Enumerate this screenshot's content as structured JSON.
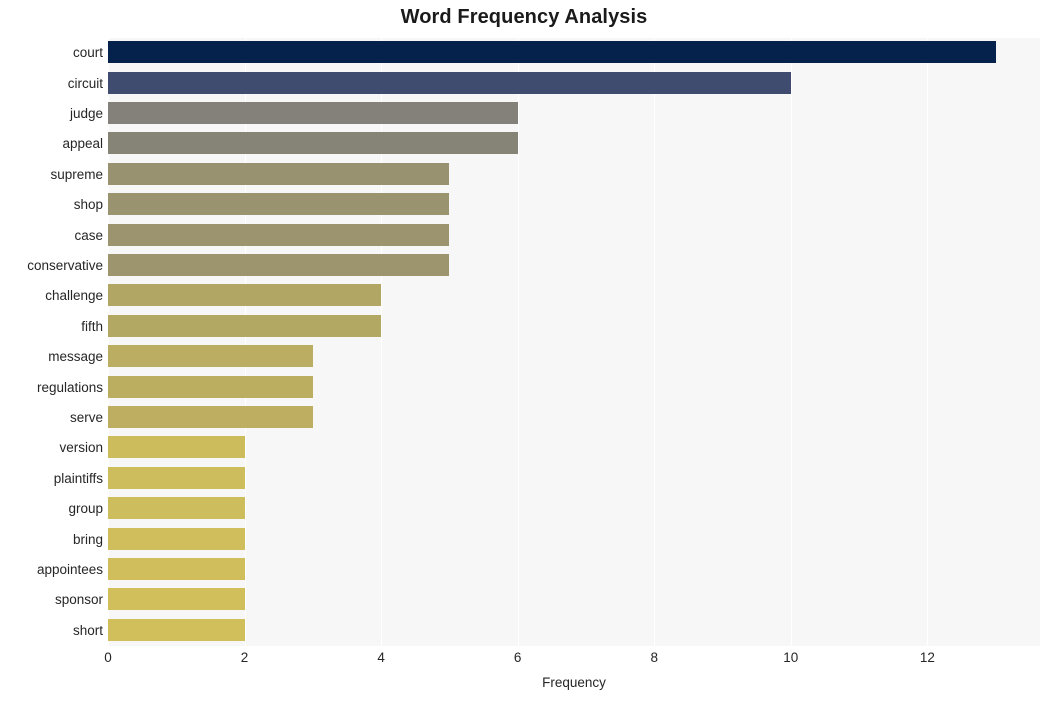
{
  "chart_data": {
    "type": "bar",
    "orientation": "horizontal",
    "title": "Word Frequency Analysis",
    "xlabel": "Frequency",
    "ylabel": "",
    "categories": [
      "court",
      "circuit",
      "judge",
      "appeal",
      "supreme",
      "shop",
      "case",
      "conservative",
      "challenge",
      "fifth",
      "message",
      "regulations",
      "serve",
      "version",
      "plaintiffs",
      "group",
      "bring",
      "appointees",
      "sponsor",
      "short"
    ],
    "values": [
      13,
      10,
      6,
      6,
      5,
      5,
      5,
      5,
      4,
      4,
      3,
      3,
      3,
      2,
      2,
      2,
      2,
      2,
      2,
      2
    ],
    "bar_colors": [
      "#04224c",
      "#404b70",
      "#83817a",
      "#868377",
      "#999270",
      "#9a936f",
      "#9b946e",
      "#9c956e",
      "#b2a665",
      "#b3a764",
      "#bbad62",
      "#bcae61",
      "#bdae61",
      "#cdbc5c",
      "#cebd5c",
      "#cebd5c",
      "#cfbe5b",
      "#cfbe5b",
      "#d0bf5b",
      "#d0bf5b"
    ],
    "xticks": [
      0,
      2,
      4,
      6,
      8,
      10,
      12
    ],
    "xtick_labels": [
      "0",
      "2",
      "4",
      "6",
      "8",
      "10",
      "12"
    ],
    "xlim": [
      0,
      13.65
    ],
    "grid": true,
    "grid_axis": "x",
    "grid_color": "#ffffff",
    "plot_background": "#f7f7f7",
    "figure_background": "#ffffff",
    "legend": null
  }
}
